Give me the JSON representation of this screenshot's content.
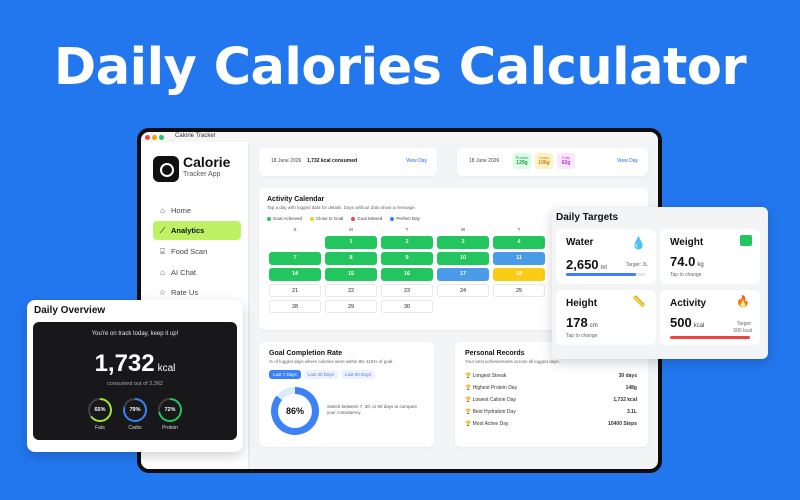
{
  "hero_title": "Daily Calories Calculator",
  "window": {
    "title": "Calorie Tracker"
  },
  "sidebar": {
    "app_name": "Calorie",
    "app_sub": "Tracker App",
    "items": [
      {
        "label": "Home",
        "icon": "home-icon",
        "active": false
      },
      {
        "label": "Analytics",
        "icon": "analytics-icon",
        "active": true
      },
      {
        "label": "Food Scan",
        "icon": "scan-icon",
        "active": false
      },
      {
        "label": "AI Chat",
        "icon": "chat-icon",
        "active": false
      },
      {
        "label": "Rate Us",
        "icon": "star-icon",
        "active": false
      }
    ]
  },
  "top_cards": {
    "left": {
      "date": "18 June 2026",
      "consumed": "1,732 kcal consumed",
      "link": "View Day"
    },
    "right": {
      "date": "18 June 2026",
      "macros": [
        {
          "label": "Protein",
          "value": "129g",
          "color": "#22c55e"
        },
        {
          "label": "Carbs",
          "value": "106g",
          "color": "#f59e0b"
        },
        {
          "label": "Fats",
          "value": "62g",
          "color": "#d946ef"
        }
      ],
      "link": "View Day"
    }
  },
  "calendar": {
    "title": "Activity Calendar",
    "desc": "Tap a day with logged data for details. Days without data show a message.",
    "legend": [
      {
        "label": "Goal Achieved",
        "color": "#22c55e"
      },
      {
        "label": "Close to Goal",
        "color": "#facc15"
      },
      {
        "label": "Goal Missed",
        "color": "#ef4444"
      },
      {
        "label": "Perfect Day",
        "color": "#3b82f6"
      }
    ],
    "weekdays": [
      "S",
      "M",
      "T",
      "W",
      "T"
    ],
    "rows": [
      [
        {
          "d": "",
          "s": ""
        },
        {
          "d": "1",
          "s": "g"
        },
        {
          "d": "2",
          "s": "g"
        },
        {
          "d": "3",
          "s": "g"
        },
        {
          "d": "4",
          "s": "g"
        }
      ],
      [
        {
          "d": "7",
          "s": "g"
        },
        {
          "d": "8",
          "s": "g"
        },
        {
          "d": "9",
          "s": "g"
        },
        {
          "d": "10",
          "s": "g"
        },
        {
          "d": "11",
          "s": "b"
        }
      ],
      [
        {
          "d": "14",
          "s": "g"
        },
        {
          "d": "15",
          "s": "g"
        },
        {
          "d": "16",
          "s": "g"
        },
        {
          "d": "17",
          "s": "b"
        },
        {
          "d": "18",
          "s": "y"
        }
      ],
      [
        {
          "d": "21",
          "s": "w"
        },
        {
          "d": "22",
          "s": "w"
        },
        {
          "d": "23",
          "s": "w"
        },
        {
          "d": "24",
          "s": "w"
        },
        {
          "d": "25",
          "s": "w"
        }
      ],
      [
        {
          "d": "28",
          "s": "w"
        },
        {
          "d": "29",
          "s": "w"
        },
        {
          "d": "30",
          "s": "w"
        },
        {
          "d": "",
          "s": ""
        },
        {
          "d": "",
          "s": ""
        }
      ]
    ]
  },
  "goal_rate": {
    "title": "Goal Completion Rate",
    "desc": "% of logged days where calories were within 85–115% of goal.",
    "tabs": [
      "Last 7 Days",
      "Last 30 Days",
      "Last 90 Days"
    ],
    "active_tab": 0,
    "percent": "86%",
    "value": 0.86,
    "note": "Switch between 7, 30, or 90 days to compare your consistency."
  },
  "records": {
    "title": "Personal Records",
    "desc": "Your best achievements across all logged days.",
    "items": [
      {
        "label": "Longest Streak",
        "value": "30 days"
      },
      {
        "label": "Highest Protein Day",
        "value": "148g"
      },
      {
        "label": "Lowest Calorie Day",
        "value": "1,732 kcal"
      },
      {
        "label": "Best Hydration Day",
        "value": "3.1L"
      },
      {
        "label": "Most Active Day",
        "value": "10400 Steps"
      }
    ]
  },
  "overview": {
    "title": "Daily Overview",
    "message": "You're on track today, keep it up!",
    "kcal": "1,732",
    "unit": "kcal",
    "consumed": "consumed out of 2,362",
    "rings": [
      {
        "pct": "65%",
        "value": 0.65,
        "label": "Fats",
        "color": "#a3e635"
      },
      {
        "pct": "79%",
        "value": 0.79,
        "label": "Carbs",
        "color": "#3b82f6"
      },
      {
        "pct": "72%",
        "value": 0.72,
        "label": "Protein",
        "color": "#22c55e"
      }
    ]
  },
  "targets": {
    "title": "Daily Targets",
    "water": {
      "label": "Water",
      "value": "2,650",
      "unit": "ml",
      "target": "Target: 3L",
      "progress": 0.88
    },
    "weight": {
      "label": "Weight",
      "value": "74.0",
      "unit": "kg",
      "sub": "Tap to change"
    },
    "height": {
      "label": "Height",
      "value": "178",
      "unit": "cm",
      "sub": "Tap to change"
    },
    "activity": {
      "label": "Activity",
      "value": "500",
      "unit": "kcal",
      "target1": "Target:",
      "target2": "500 kcal",
      "progress": 1.0
    }
  }
}
